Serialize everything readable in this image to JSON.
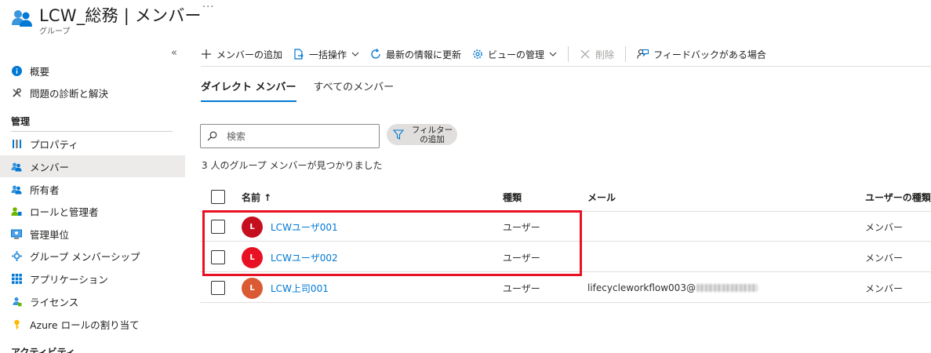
{
  "header": {
    "title": "LCW_総務 | メンバー",
    "subtitle": "グループ",
    "more": "···"
  },
  "sidebar": {
    "collapse": "«",
    "items_top": [
      {
        "label": "概要",
        "icon": "info-icon"
      },
      {
        "label": "問題の診断と解決",
        "icon": "wrench-icon"
      }
    ],
    "section_manage": "管理",
    "items_manage": [
      {
        "label": "プロパティ",
        "icon": "properties-icon"
      },
      {
        "label": "メンバー",
        "icon": "members-icon",
        "selected": true
      },
      {
        "label": "所有者",
        "icon": "owners-icon"
      },
      {
        "label": "ロールと管理者",
        "icon": "roles-icon"
      },
      {
        "label": "管理単位",
        "icon": "admin-units-icon"
      },
      {
        "label": "グループ メンバーシップ",
        "icon": "membership-icon"
      },
      {
        "label": "アプリケーション",
        "icon": "apps-icon"
      },
      {
        "label": "ライセンス",
        "icon": "license-icon"
      },
      {
        "label": "Azure ロールの割り当て",
        "icon": "key-icon"
      }
    ],
    "section_activity": "アクティビティ"
  },
  "toolbar": {
    "add_member": "メンバーの追加",
    "bulk": "一括操作",
    "refresh": "最新の情報に更新",
    "view_manage": "ビューの管理",
    "delete": "削除",
    "feedback": "フィードバックがある場合"
  },
  "tabs": [
    {
      "label": "ダイレクト メンバー",
      "active": true
    },
    {
      "label": "すべてのメンバー",
      "active": false
    }
  ],
  "search": {
    "placeholder": "検索"
  },
  "filter": {
    "label": "フィルター の追加"
  },
  "result_count": "3 人のグループ メンバーが見つかりました",
  "table": {
    "columns": {
      "name": "名前 ↑",
      "type": "種類",
      "email": "メール",
      "user_type": "ユーザーの種類"
    },
    "rows": [
      {
        "initial": "L",
        "name": "LCWユーザ001",
        "type": "ユーザー",
        "email": "",
        "user_type": "メンバー",
        "avatar_color": "#c50f1f"
      },
      {
        "initial": "L",
        "name": "LCWユーザ002",
        "type": "ユーザー",
        "email": "",
        "user_type": "メンバー",
        "avatar_color": "#e81123"
      },
      {
        "initial": "L",
        "name": "LCW上司001",
        "type": "ユーザー",
        "email": "lifecycleworkflow003@",
        "user_type": "メンバー",
        "avatar_color": "#da5a33"
      }
    ]
  },
  "colors": {
    "accent": "#0078d4",
    "highlight": "#e81123",
    "selected_bg": "#edebe9"
  }
}
